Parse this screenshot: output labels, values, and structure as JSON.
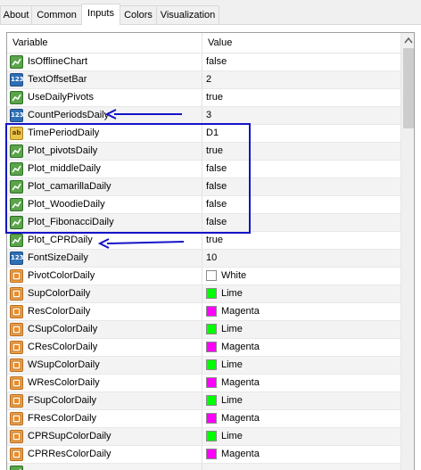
{
  "tabs": [
    {
      "label": "About"
    },
    {
      "label": "Common"
    },
    {
      "label": "Inputs"
    },
    {
      "label": "Colors"
    },
    {
      "label": "Visualization"
    }
  ],
  "grid": {
    "header": {
      "variable": "Variable",
      "value": "Value"
    },
    "rows": [
      {
        "icon": "bool-icon",
        "variable": "IsOfflineChart",
        "value": "false"
      },
      {
        "icon": "number-icon",
        "variable": "TextOffsetBar",
        "value": "2"
      },
      {
        "icon": "bool-icon",
        "variable": "UseDailyPivots",
        "value": "true"
      },
      {
        "icon": "number-icon",
        "variable": "CountPeriodsDaily",
        "value": "3"
      },
      {
        "icon": "string-icon",
        "variable": "TimePeriodDaily",
        "value": "D1"
      },
      {
        "icon": "bool-icon",
        "variable": "Plot_pivotsDaily",
        "value": "true"
      },
      {
        "icon": "bool-icon",
        "variable": "Plot_middleDaily",
        "value": "false"
      },
      {
        "icon": "bool-icon",
        "variable": "Plot_camarillaDaily",
        "value": "false"
      },
      {
        "icon": "bool-icon",
        "variable": "Plot_WoodieDaily",
        "value": "false"
      },
      {
        "icon": "bool-icon",
        "variable": "Plot_FibonacciDaily",
        "value": "false"
      },
      {
        "icon": "bool-icon",
        "variable": "Plot_CPRDaily",
        "value": "true"
      },
      {
        "icon": "number-icon",
        "variable": "FontSizeDaily",
        "value": "10"
      },
      {
        "icon": "color-icon",
        "variable": "PivotColorDaily",
        "value": "White",
        "swatch": "#ffffff"
      },
      {
        "icon": "color-icon",
        "variable": "SupColorDaily",
        "value": "Lime",
        "swatch": "#00ff00"
      },
      {
        "icon": "color-icon",
        "variable": "ResColorDaily",
        "value": "Magenta",
        "swatch": "#ff00ff"
      },
      {
        "icon": "color-icon",
        "variable": "CSupColorDaily",
        "value": "Lime",
        "swatch": "#00ff00"
      },
      {
        "icon": "color-icon",
        "variable": "CResColorDaily",
        "value": "Magenta",
        "swatch": "#ff00ff"
      },
      {
        "icon": "color-icon",
        "variable": "WSupColorDaily",
        "value": "Lime",
        "swatch": "#00ff00"
      },
      {
        "icon": "color-icon",
        "variable": "WResColorDaily",
        "value": "Magenta",
        "swatch": "#ff00ff"
      },
      {
        "icon": "color-icon",
        "variable": "FSupColorDaily",
        "value": "Lime",
        "swatch": "#00ff00"
      },
      {
        "icon": "color-icon",
        "variable": "FResColorDaily",
        "value": "Magenta",
        "swatch": "#ff00ff"
      },
      {
        "icon": "color-icon",
        "variable": "CPRSupColorDaily",
        "value": "Lime",
        "swatch": "#00ff00"
      },
      {
        "icon": "color-icon",
        "variable": "CPRResColorDaily",
        "value": "Magenta",
        "swatch": "#ff00ff"
      },
      {
        "icon": "bool-icon",
        "variable": "",
        "value": ""
      }
    ]
  },
  "colors": {
    "annotation": "#1414c8",
    "active_tab_bg": "#ffffff"
  }
}
